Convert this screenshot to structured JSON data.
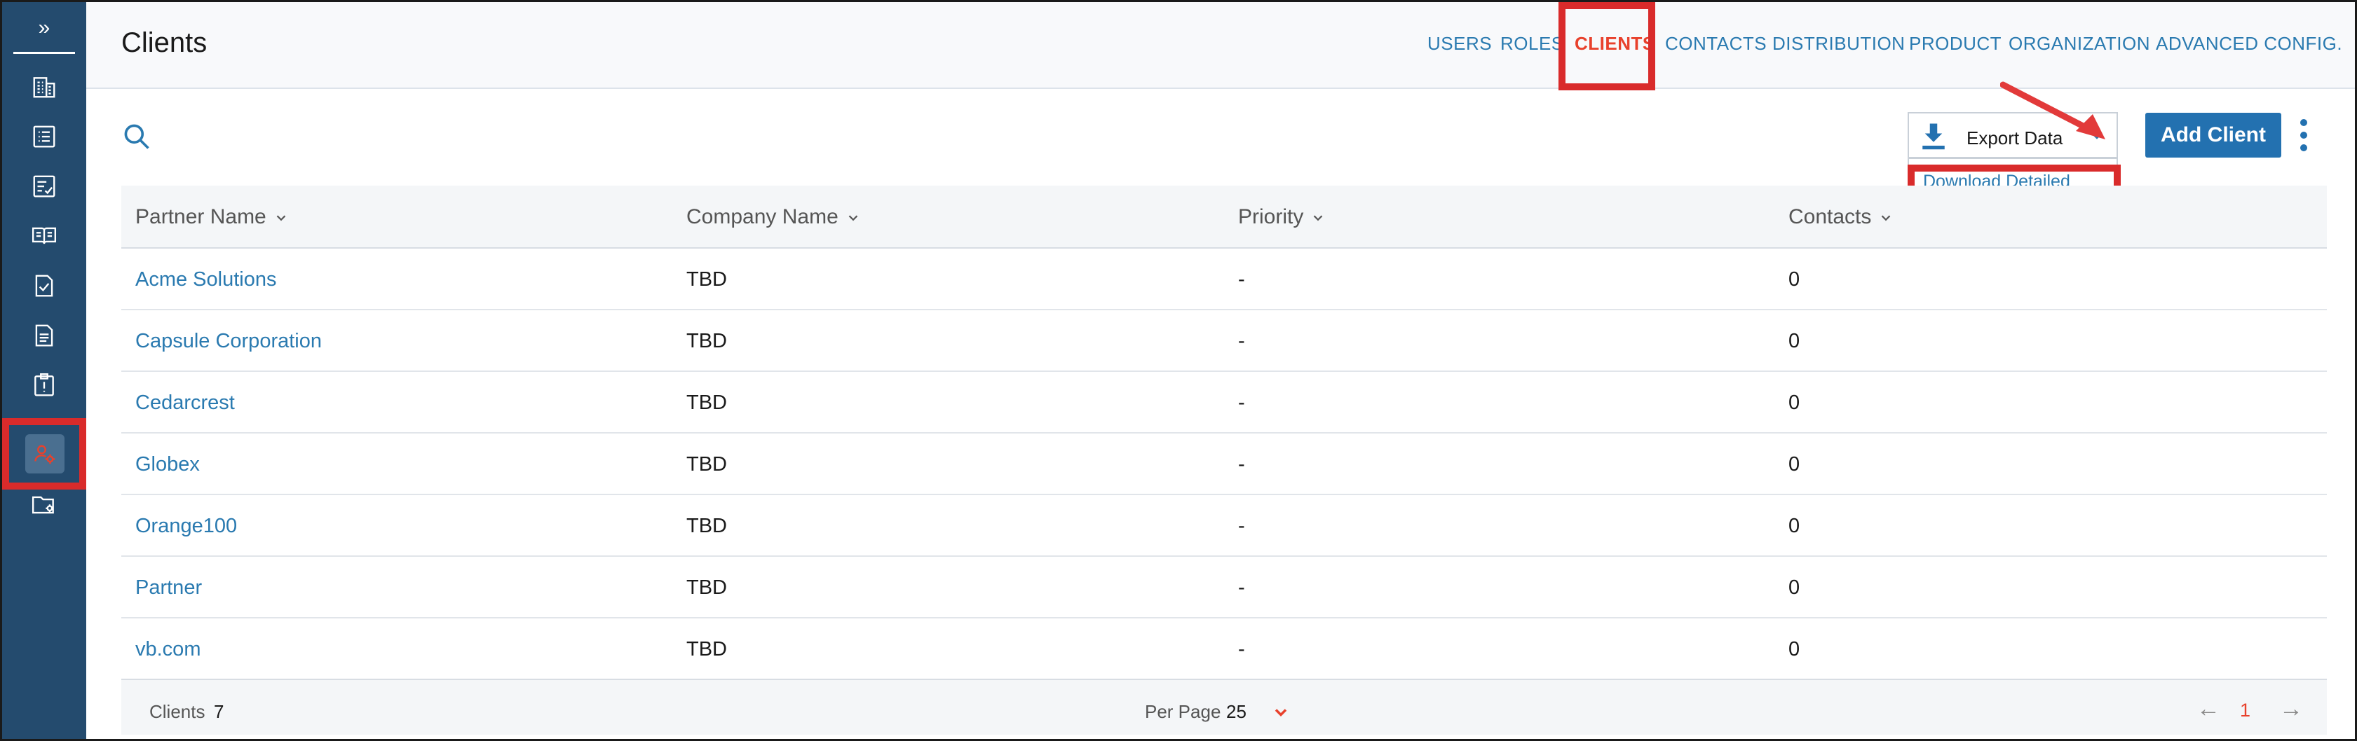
{
  "sidebar": {
    "expand_label": "»",
    "items": [
      {
        "icon": "building-icon"
      },
      {
        "icon": "list-icon"
      },
      {
        "icon": "checklist-icon"
      },
      {
        "icon": "book-icon"
      },
      {
        "icon": "file-check-icon"
      },
      {
        "icon": "document-icon"
      },
      {
        "icon": "clipboard-alert-icon"
      },
      {
        "icon": "users-gear-icon",
        "active": true
      },
      {
        "icon": "folder-gear-icon"
      }
    ]
  },
  "header": {
    "title": "Clients",
    "nav": [
      "USERS",
      "ROLES",
      "CLIENTS",
      "CONTACTS",
      "DISTRIBUTION",
      "PRODUCT",
      "ORGANIZATION",
      "ADVANCED CONFIG."
    ],
    "active_nav": "CLIENTS"
  },
  "toolbar": {
    "search_icon": "search-icon",
    "export_label": "Export Data",
    "export_menu_item": "Download Detailed Report",
    "add_label": "Add Client"
  },
  "table": {
    "columns": [
      "Partner Name",
      "Company Name",
      "Priority",
      "Contacts"
    ],
    "rows": [
      {
        "partner": "Acme Solutions",
        "company": "TBD",
        "priority": "-",
        "contacts": "0"
      },
      {
        "partner": "Capsule Corporation",
        "company": "TBD",
        "priority": "-",
        "contacts": "0"
      },
      {
        "partner": "Cedarcrest",
        "company": "TBD",
        "priority": "-",
        "contacts": "0"
      },
      {
        "partner": "Globex",
        "company": "TBD",
        "priority": "-",
        "contacts": "0"
      },
      {
        "partner": "Orange100",
        "company": "TBD",
        "priority": "-",
        "contacts": "0"
      },
      {
        "partner": "Partner",
        "company": "TBD",
        "priority": "-",
        "contacts": "0"
      },
      {
        "partner": "vb.com",
        "company": "TBD",
        "priority": "-",
        "contacts": "0"
      }
    ]
  },
  "footer": {
    "count_label": "Clients",
    "count": "7",
    "per_page_label": "Per Page",
    "per_page": "25",
    "prev": "←",
    "page": "1",
    "next": "→"
  },
  "colors": {
    "sidebar": "#244b6e",
    "accent": "#2371b0",
    "link": "#2a7ab0",
    "active": "#e8412c",
    "annotation": "#d92b2b"
  }
}
